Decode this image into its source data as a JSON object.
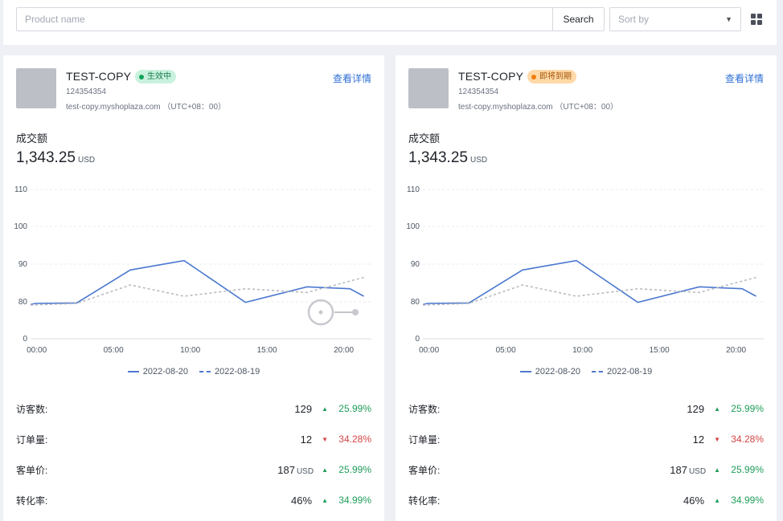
{
  "search": {
    "placeholder": "Product name",
    "button_label": "Search"
  },
  "sort": {
    "placeholder": "Sort by"
  },
  "chart_axis": {
    "y_ticks": [
      "110",
      "100",
      "90",
      "80",
      "0"
    ],
    "x_ticks": [
      "00:00",
      "05:00",
      "10:00",
      "15:00",
      "20:00"
    ]
  },
  "cards": [
    {
      "shop_name": "TEST-COPY",
      "status": "生效中",
      "status_color": "#13a35a",
      "shop_id": "124354354",
      "domain": "test-copy.myshoplaza.com （UTC+08：00）",
      "detail_link": "查看详情",
      "sales_label": "成交额",
      "sales_value": "1,343.25",
      "sales_unit": "USD",
      "legend": [
        "2022-08-20",
        "2022-08-19"
      ],
      "metrics": [
        {
          "label": "访客数:",
          "value": "129",
          "unit": "",
          "direction": "up",
          "change": "25.99%"
        },
        {
          "label": "订单量:",
          "value": "12",
          "unit": "",
          "direction": "down",
          "change": "34.28%"
        },
        {
          "label": "客单价:",
          "value": "187",
          "unit": "USD",
          "direction": "up",
          "change": "25.99%"
        },
        {
          "label": "转化率:",
          "value": "46%",
          "unit": "",
          "direction": "up",
          "change": "34.99%"
        }
      ]
    },
    {
      "shop_name": "TEST-COPY",
      "status": "即将到期",
      "status_color": "#f27c0c",
      "shop_id": "124354354",
      "domain": "test-copy.myshoplaza.com （UTC+08：00）",
      "detail_link": "查看详情",
      "sales_label": "成交额",
      "sales_value": "1,343.25",
      "sales_unit": "USD",
      "legend": [
        "2022-08-20",
        "2022-08-19"
      ],
      "metrics": [
        {
          "label": "访客数:",
          "value": "129",
          "unit": "",
          "direction": "up",
          "change": "25.99%"
        },
        {
          "label": "订单量:",
          "value": "12",
          "unit": "",
          "direction": "down",
          "change": "34.28%"
        },
        {
          "label": "客单价:",
          "value": "187",
          "unit": "USD",
          "direction": "up",
          "change": "25.99%"
        },
        {
          "label": "转化率:",
          "value": "46%",
          "unit": "",
          "direction": "up",
          "change": "34.99%"
        }
      ]
    }
  ],
  "chart_data": [
    {
      "type": "line",
      "xlabel": "",
      "ylabel": "",
      "x_hours": [
        0,
        0.3,
        3,
        6.5,
        10,
        14,
        18,
        20.8,
        21.7
      ],
      "x_hours_b": [
        0,
        3,
        6.5,
        10,
        14,
        18,
        21.7
      ],
      "yticks": [
        0,
        80,
        90,
        100,
        110
      ],
      "series": [
        {
          "name": "2022-08-20",
          "x": [
            0,
            0.3,
            3,
            6.5,
            10,
            14,
            18,
            20.8,
            21.7
          ],
          "values": [
            74,
            76.5,
            77.5,
            88.5,
            91,
            79,
            84,
            83.5,
            81.5
          ],
          "style": "solid",
          "color": "#4a78d0"
        },
        {
          "name": "2022-08-19",
          "x": [
            0,
            3,
            6.5,
            10,
            14,
            18,
            21.7
          ],
          "values": [
            73,
            76.5,
            84.5,
            81.5,
            83.5,
            82.5,
            86.5
          ],
          "style": "dashed",
          "color": "#b8babf"
        }
      ]
    },
    {
      "type": "line",
      "xlabel": "",
      "ylabel": "",
      "yticks": [
        0,
        80,
        90,
        100,
        110
      ],
      "series": [
        {
          "name": "2022-08-20",
          "x": [
            0,
            0.3,
            3,
            6.5,
            10,
            14,
            18,
            20.8,
            21.7
          ],
          "values": [
            74,
            76.5,
            77.5,
            88.5,
            91,
            79,
            84,
            83.5,
            81.5
          ],
          "style": "solid",
          "color": "#4a78d0"
        },
        {
          "name": "2022-08-19",
          "x": [
            0,
            3,
            6.5,
            10,
            14,
            18,
            21.7
          ],
          "values": [
            73,
            76.5,
            84.5,
            81.5,
            83.5,
            82.5,
            86.5
          ],
          "style": "dashed",
          "color": "#b8babf"
        }
      ]
    }
  ]
}
